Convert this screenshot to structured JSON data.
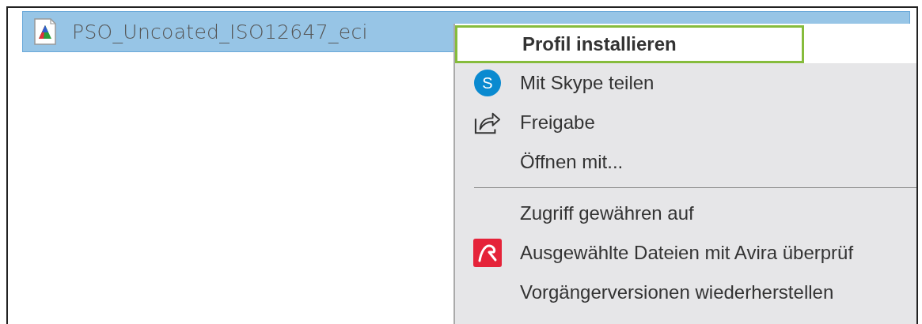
{
  "file": {
    "name": "PSO_Uncoated_ISO12647_eci",
    "selected": true
  },
  "context_menu": {
    "items": [
      {
        "kind": "plain",
        "label": "Profil installieren",
        "bold": true,
        "selected": true
      },
      {
        "kind": "skype",
        "icon_text": "S",
        "label": "Mit Skype teilen",
        "bold": false,
        "selected": false
      },
      {
        "kind": "share",
        "label": "Freigabe",
        "bold": false,
        "selected": false
      },
      {
        "kind": "plain",
        "label": "Öffnen mit...",
        "bold": false,
        "selected": false
      },
      {
        "kind": "separator"
      },
      {
        "kind": "plain",
        "label": "Zugriff gewähren auf",
        "bold": false,
        "selected": false
      },
      {
        "kind": "avira",
        "label": "Ausgewählte Dateien mit Avira überprüf",
        "bold": false,
        "selected": false
      },
      {
        "kind": "plain",
        "label": "Vorgängerversionen wiederherstellen",
        "bold": false,
        "selected": false
      }
    ]
  }
}
